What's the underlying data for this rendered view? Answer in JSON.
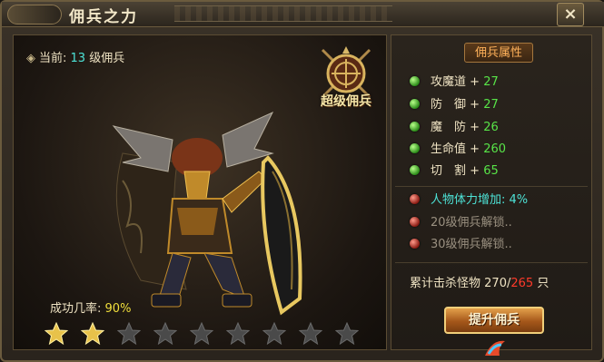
{
  "window": {
    "title": "佣兵之力",
    "close_label": "×"
  },
  "left": {
    "current_prefix": "当前:",
    "current_level": "13",
    "current_suffix": "级佣兵",
    "badge_label": "超级佣兵",
    "success_label": "成功几率:",
    "success_rate": "90%",
    "stars_total": 9,
    "stars_filled": 2,
    "star_filled_color": "#e8c24a",
    "star_empty_color": "#4a4a4a"
  },
  "right": {
    "header": "佣兵属性",
    "attributes": [
      {
        "name": "攻魔道",
        "plus": "+",
        "value": "27"
      },
      {
        "name": "防　御",
        "plus": "+",
        "value": "27"
      },
      {
        "name": "魔　防",
        "plus": "+",
        "value": "26"
      },
      {
        "name": "生命值",
        "plus": "+",
        "value": "260"
      },
      {
        "name": "切　割",
        "plus": "+",
        "value": "65"
      }
    ],
    "bonus": "人物体力增加: 4%",
    "locked": [
      "20级佣兵解锁..",
      "30级佣兵解锁.."
    ],
    "kills_label": "累计击杀怪物",
    "kills_current": "270",
    "kills_sep": "/",
    "kills_max": "265",
    "kills_unit": "只",
    "upgrade_label": "提升佣兵"
  }
}
